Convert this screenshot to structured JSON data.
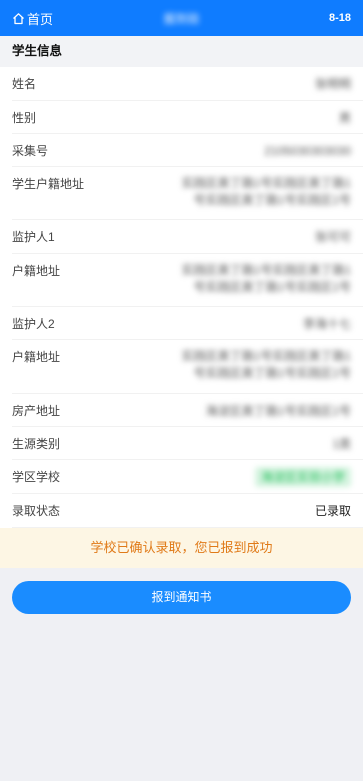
{
  "header": {
    "home_label": "首页",
    "title": "报到验",
    "right_text": "8-18"
  },
  "section": {
    "title": "学生信息"
  },
  "rows": [
    {
      "label": "姓名",
      "value": "张明明"
    },
    {
      "label": "性别",
      "value": "男"
    },
    {
      "label": "采集号",
      "value": "2105030303030"
    },
    {
      "label": "学生户籍地址",
      "value": "实践区奥丁路1号实践区奥丁路1号实践区奥丁路1号实践区1号"
    },
    {
      "label": "监护人1",
      "value": "张可可"
    },
    {
      "label": "户籍地址",
      "value": "实践区奥丁路1号实践区奥丁路1号实践区奥丁路1号实践区1号"
    },
    {
      "label": "监护人2",
      "value": "李海十七"
    },
    {
      "label": "户籍地址",
      "value": "实践区奥丁路1号实践区奥丁路1号实践区奥丁路1号实践区1号"
    },
    {
      "label": "房产地址",
      "value": "海淀区奥丁路1号实践区1号"
    },
    {
      "label": "生源类别",
      "value": "1类"
    },
    {
      "label": "学区学校",
      "value": "海淀区实验小学"
    },
    {
      "label": "录取状态",
      "value": "已录取"
    }
  ],
  "status": {
    "message": "学校已确认录取，您已报到成功"
  },
  "button": {
    "label": "报到通知书"
  },
  "colors": {
    "header_bg": "#0f7cff",
    "status_bg": "#fdf6e4",
    "status_text": "#e07a18",
    "button_bg": "#1a8cff",
    "school_green": "#1ebd57"
  }
}
